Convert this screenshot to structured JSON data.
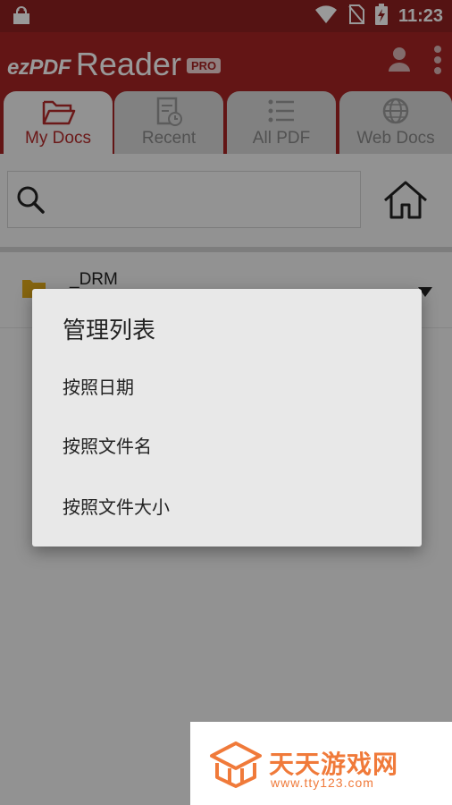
{
  "status_bar": {
    "time": "11:23",
    "icons": [
      "shop-bag-icon",
      "wifi-icon",
      "no-sim-icon",
      "battery-charging-icon"
    ]
  },
  "app_bar": {
    "logo_prefix": "ezPDF",
    "logo_name": "Reader",
    "logo_badge": "PRO",
    "icons": [
      "user-icon",
      "more-vert-icon"
    ]
  },
  "tabs": [
    {
      "label": "My Docs",
      "icon": "folder-open-icon",
      "active": true
    },
    {
      "label": "Recent",
      "icon": "recent-doc-icon",
      "active": false
    },
    {
      "label": "All PDF",
      "icon": "list-icon",
      "active": false
    },
    {
      "label": "Web Docs",
      "icon": "globe-icon",
      "active": false
    }
  ],
  "search": {
    "placeholder": "",
    "icon": "search-icon"
  },
  "home_icon": "home-icon",
  "files": [
    {
      "name": "_DRM",
      "icon": "folder-icon"
    }
  ],
  "dialog": {
    "title": "管理列表",
    "options": [
      "按照日期",
      "按照文件名",
      "按照文件大小"
    ]
  },
  "watermark": {
    "title": "天天游戏网",
    "url": "www.tty123.com"
  },
  "colors": {
    "status_bar": "#8e2020",
    "app_bar": "#a52424",
    "accent": "#b32a2a",
    "watermark": "#f07a3a"
  }
}
